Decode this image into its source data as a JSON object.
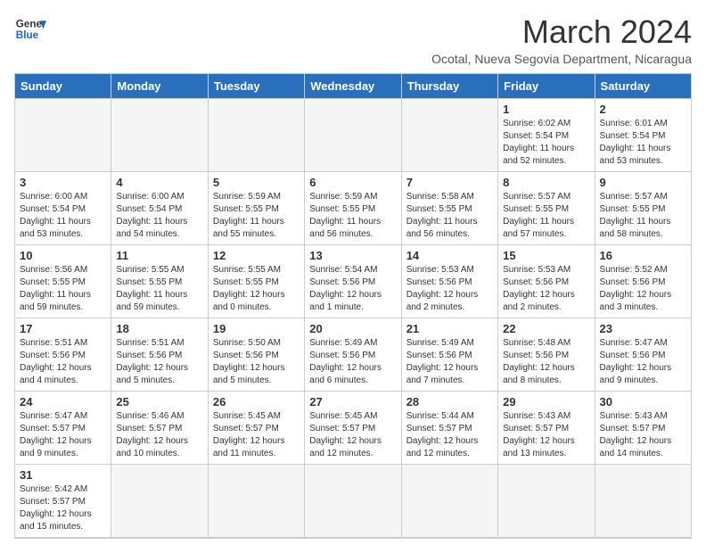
{
  "header": {
    "logo_text_general": "General",
    "logo_text_blue": "Blue",
    "month_title": "March 2024",
    "subtitle": "Ocotal, Nueva Segovia Department, Nicaragua"
  },
  "days_of_week": [
    "Sunday",
    "Monday",
    "Tuesday",
    "Wednesday",
    "Thursday",
    "Friday",
    "Saturday"
  ],
  "weeks": [
    [
      {
        "day": "",
        "empty": true
      },
      {
        "day": "",
        "empty": true
      },
      {
        "day": "",
        "empty": true
      },
      {
        "day": "",
        "empty": true
      },
      {
        "day": "",
        "empty": true
      },
      {
        "day": "1",
        "sunrise": "Sunrise: 6:02 AM",
        "sunset": "Sunset: 5:54 PM",
        "daylight": "Daylight: 11 hours and 52 minutes."
      },
      {
        "day": "2",
        "sunrise": "Sunrise: 6:01 AM",
        "sunset": "Sunset: 5:54 PM",
        "daylight": "Daylight: 11 hours and 53 minutes."
      }
    ],
    [
      {
        "day": "3",
        "sunrise": "Sunrise: 6:00 AM",
        "sunset": "Sunset: 5:54 PM",
        "daylight": "Daylight: 11 hours and 53 minutes."
      },
      {
        "day": "4",
        "sunrise": "Sunrise: 6:00 AM",
        "sunset": "Sunset: 5:54 PM",
        "daylight": "Daylight: 11 hours and 54 minutes."
      },
      {
        "day": "5",
        "sunrise": "Sunrise: 5:59 AM",
        "sunset": "Sunset: 5:55 PM",
        "daylight": "Daylight: 11 hours and 55 minutes."
      },
      {
        "day": "6",
        "sunrise": "Sunrise: 5:59 AM",
        "sunset": "Sunset: 5:55 PM",
        "daylight": "Daylight: 11 hours and 56 minutes."
      },
      {
        "day": "7",
        "sunrise": "Sunrise: 5:58 AM",
        "sunset": "Sunset: 5:55 PM",
        "daylight": "Daylight: 11 hours and 56 minutes."
      },
      {
        "day": "8",
        "sunrise": "Sunrise: 5:57 AM",
        "sunset": "Sunset: 5:55 PM",
        "daylight": "Daylight: 11 hours and 57 minutes."
      },
      {
        "day": "9",
        "sunrise": "Sunrise: 5:57 AM",
        "sunset": "Sunset: 5:55 PM",
        "daylight": "Daylight: 11 hours and 58 minutes."
      }
    ],
    [
      {
        "day": "10",
        "sunrise": "Sunrise: 5:56 AM",
        "sunset": "Sunset: 5:55 PM",
        "daylight": "Daylight: 11 hours and 59 minutes."
      },
      {
        "day": "11",
        "sunrise": "Sunrise: 5:55 AM",
        "sunset": "Sunset: 5:55 PM",
        "daylight": "Daylight: 11 hours and 59 minutes."
      },
      {
        "day": "12",
        "sunrise": "Sunrise: 5:55 AM",
        "sunset": "Sunset: 5:55 PM",
        "daylight": "Daylight: 12 hours and 0 minutes."
      },
      {
        "day": "13",
        "sunrise": "Sunrise: 5:54 AM",
        "sunset": "Sunset: 5:56 PM",
        "daylight": "Daylight: 12 hours and 1 minute."
      },
      {
        "day": "14",
        "sunrise": "Sunrise: 5:53 AM",
        "sunset": "Sunset: 5:56 PM",
        "daylight": "Daylight: 12 hours and 2 minutes."
      },
      {
        "day": "15",
        "sunrise": "Sunrise: 5:53 AM",
        "sunset": "Sunset: 5:56 PM",
        "daylight": "Daylight: 12 hours and 2 minutes."
      },
      {
        "day": "16",
        "sunrise": "Sunrise: 5:52 AM",
        "sunset": "Sunset: 5:56 PM",
        "daylight": "Daylight: 12 hours and 3 minutes."
      }
    ],
    [
      {
        "day": "17",
        "sunrise": "Sunrise: 5:51 AM",
        "sunset": "Sunset: 5:56 PM",
        "daylight": "Daylight: 12 hours and 4 minutes."
      },
      {
        "day": "18",
        "sunrise": "Sunrise: 5:51 AM",
        "sunset": "Sunset: 5:56 PM",
        "daylight": "Daylight: 12 hours and 5 minutes."
      },
      {
        "day": "19",
        "sunrise": "Sunrise: 5:50 AM",
        "sunset": "Sunset: 5:56 PM",
        "daylight": "Daylight: 12 hours and 5 minutes."
      },
      {
        "day": "20",
        "sunrise": "Sunrise: 5:49 AM",
        "sunset": "Sunset: 5:56 PM",
        "daylight": "Daylight: 12 hours and 6 minutes."
      },
      {
        "day": "21",
        "sunrise": "Sunrise: 5:49 AM",
        "sunset": "Sunset: 5:56 PM",
        "daylight": "Daylight: 12 hours and 7 minutes."
      },
      {
        "day": "22",
        "sunrise": "Sunrise: 5:48 AM",
        "sunset": "Sunset: 5:56 PM",
        "daylight": "Daylight: 12 hours and 8 minutes."
      },
      {
        "day": "23",
        "sunrise": "Sunrise: 5:47 AM",
        "sunset": "Sunset: 5:56 PM",
        "daylight": "Daylight: 12 hours and 9 minutes."
      }
    ],
    [
      {
        "day": "24",
        "sunrise": "Sunrise: 5:47 AM",
        "sunset": "Sunset: 5:57 PM",
        "daylight": "Daylight: 12 hours and 9 minutes."
      },
      {
        "day": "25",
        "sunrise": "Sunrise: 5:46 AM",
        "sunset": "Sunset: 5:57 PM",
        "daylight": "Daylight: 12 hours and 10 minutes."
      },
      {
        "day": "26",
        "sunrise": "Sunrise: 5:45 AM",
        "sunset": "Sunset: 5:57 PM",
        "daylight": "Daylight: 12 hours and 11 minutes."
      },
      {
        "day": "27",
        "sunrise": "Sunrise: 5:45 AM",
        "sunset": "Sunset: 5:57 PM",
        "daylight": "Daylight: 12 hours and 12 minutes."
      },
      {
        "day": "28",
        "sunrise": "Sunrise: 5:44 AM",
        "sunset": "Sunset: 5:57 PM",
        "daylight": "Daylight: 12 hours and 12 minutes."
      },
      {
        "day": "29",
        "sunrise": "Sunrise: 5:43 AM",
        "sunset": "Sunset: 5:57 PM",
        "daylight": "Daylight: 12 hours and 13 minutes."
      },
      {
        "day": "30",
        "sunrise": "Sunrise: 5:43 AM",
        "sunset": "Sunset: 5:57 PM",
        "daylight": "Daylight: 12 hours and 14 minutes."
      }
    ],
    [
      {
        "day": "31",
        "sunrise": "Sunrise: 5:42 AM",
        "sunset": "Sunset: 5:57 PM",
        "daylight": "Daylight: 12 hours and 15 minutes."
      },
      {
        "day": "",
        "empty": true
      },
      {
        "day": "",
        "empty": true
      },
      {
        "day": "",
        "empty": true
      },
      {
        "day": "",
        "empty": true
      },
      {
        "day": "",
        "empty": true
      },
      {
        "day": "",
        "empty": true
      }
    ]
  ]
}
